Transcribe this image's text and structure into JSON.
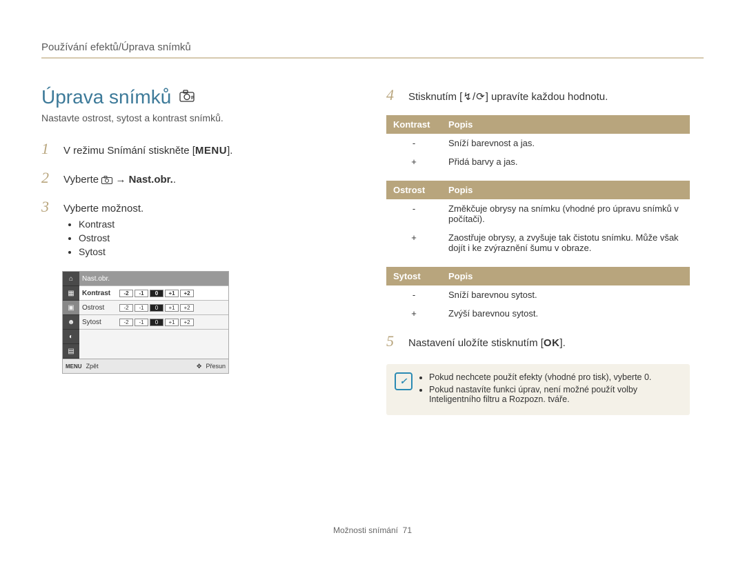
{
  "header": "Používání efektů/Úprava snímků",
  "left": {
    "title": "Úprava snímků",
    "mode_icon": "camera-p-icon",
    "subtitle": "Nastavte ostrost, sytost a kontrast snímků.",
    "step1_a": "V režimu Snímání stiskněte [",
    "step1_menu": "MENU",
    "step1_b": "].",
    "step2_a": "Vyberte ",
    "step2_b": " → ",
    "step2_bold": "Nast.obr.",
    "step2_c": ".",
    "step3": "Vyberte možnost.",
    "step3_sub": [
      "Kontrast",
      "Ostrost",
      "Sytost"
    ],
    "lcd": {
      "nastobr": "Nast.obr.",
      "rows": [
        {
          "label": "Kontrast",
          "bold": true
        },
        {
          "label": "Ostrost",
          "bold": false
        },
        {
          "label": "Sytost",
          "bold": false
        }
      ],
      "scale": [
        "-2",
        "-1",
        "0",
        "+1",
        "+2"
      ],
      "footer_left_icon": "MENU",
      "footer_left": "Zpět",
      "footer_right_icon": "✥",
      "footer_right": "Přesun"
    }
  },
  "right": {
    "step4_a": "Stisknutím [",
    "step4_k1": "↯",
    "step4_sep": "/",
    "step4_k2": "⟳",
    "step4_b": "] upravíte každou hodnotu.",
    "tables": [
      {
        "h1": "Kontrast",
        "h2": "Popis",
        "rows": [
          {
            "k": "-",
            "d": "Sníží barevnost a jas."
          },
          {
            "k": "+",
            "d": "Přidá barvy a jas."
          }
        ]
      },
      {
        "h1": "Ostrost",
        "h2": "Popis",
        "rows": [
          {
            "k": "-",
            "d": "Změkčuje obrysy na snímku (vhodné pro úpravu snímků v počítači)."
          },
          {
            "k": "+",
            "d": "Zaostřuje obrysy, a zvyšuje tak čistotu snímku. Může však dojít i ke zvýraznění šumu v obraze."
          }
        ]
      },
      {
        "h1": "Sytost",
        "h2": "Popis",
        "rows": [
          {
            "k": "-",
            "d": "Sníží barevnou sytost."
          },
          {
            "k": "+",
            "d": "Zvýší barevnou sytost."
          }
        ]
      }
    ],
    "step5_a": "Nastavení uložíte stisknutím [",
    "step5_ok": "OK",
    "step5_b": "].",
    "note": [
      "Pokud nechcete použít efekty (vhodné pro tisk), vyberte 0.",
      "Pokud nastavíte funkci úprav, není možné použít volby Inteligentního filtru a Rozpozn. tváře."
    ]
  },
  "footer_label": "Možnosti snímání",
  "footer_page": "71"
}
